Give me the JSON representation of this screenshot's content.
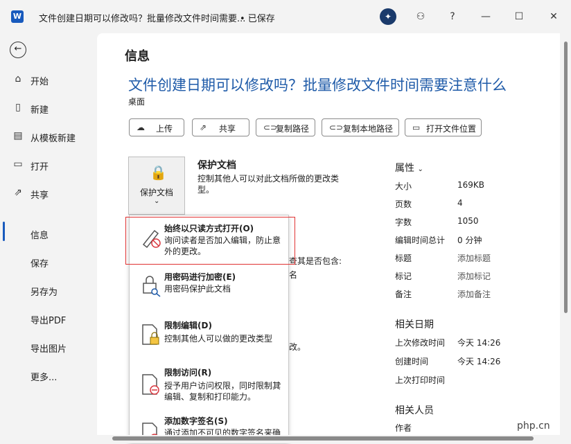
{
  "titlebar": {
    "app_logo": "W",
    "doc_title": "文件创建日期可以修改吗？批量修改文件时间需要...",
    "save_status": "• 已保存",
    "help": "?"
  },
  "sidebar": {
    "items": [
      {
        "label": "开始"
      },
      {
        "label": "新建"
      },
      {
        "label": "从模板新建"
      },
      {
        "label": "打开"
      },
      {
        "label": "共享"
      },
      {
        "label": "信息"
      },
      {
        "label": "保存"
      },
      {
        "label": "另存为"
      },
      {
        "label": "导出PDF"
      },
      {
        "label": "导出图片"
      },
      {
        "label": "更多..."
      }
    ]
  },
  "info": {
    "page_title": "信息",
    "doc_title": "文件创建日期可以修改吗？批量修改文件时间需要注意什么",
    "location": "桌面",
    "actions": [
      {
        "label": "上传"
      },
      {
        "label": "共享"
      },
      {
        "label": "复制路径"
      },
      {
        "label": "复制本地路径"
      },
      {
        "label": "打开文件位置"
      }
    ],
    "protect": {
      "button_label": "保护文档",
      "title": "保护文档",
      "desc": "控制其他人可以对此文档所做的更改类型。"
    },
    "hidden_text": {
      "inspect_fragment": "查其是否包含:",
      "name_fragment": "名",
      "change_fragment": "改。"
    }
  },
  "properties": {
    "title": "属性",
    "rows": [
      {
        "key": "大小",
        "value": "169KB"
      },
      {
        "key": "页数",
        "value": "4"
      },
      {
        "key": "字数",
        "value": "1050"
      },
      {
        "key": "编辑时间总计",
        "value": "0 分钟"
      },
      {
        "key": "标题",
        "value": "添加标题"
      },
      {
        "key": "标记",
        "value": "添加标记"
      },
      {
        "key": "备注",
        "value": "添加备注"
      }
    ],
    "dates_title": "相关日期",
    "dates": [
      {
        "key": "上次修改时间",
        "value": "今天 14:26"
      },
      {
        "key": "创建时间",
        "value": "今天 14:26"
      },
      {
        "key": "上次打印时间",
        "value": ""
      }
    ],
    "people_title": "相关人员",
    "author_key": "作者"
  },
  "dropdown": {
    "items": [
      {
        "title": "始终以只读方式打开(O)",
        "desc": "询问读者是否加入编辑，防止意外的更改。"
      },
      {
        "title": "用密码进行加密(E)",
        "desc": "用密码保护此文档"
      },
      {
        "title": "限制编辑(D)",
        "desc": "控制其他人可以做的更改类型"
      },
      {
        "title": "限制访问(R)",
        "desc": "授予用户访问权限，同时限制其编辑、复制和打印能力。"
      },
      {
        "title": "添加数字签名(S)",
        "desc": "通过添加不可见的数字签名来确保文档的完整性"
      }
    ]
  },
  "watermark": "php.cn",
  "colors": {
    "accent": "#185abd",
    "title_blue": "#1e5aa8",
    "highlight": "#e03131"
  }
}
